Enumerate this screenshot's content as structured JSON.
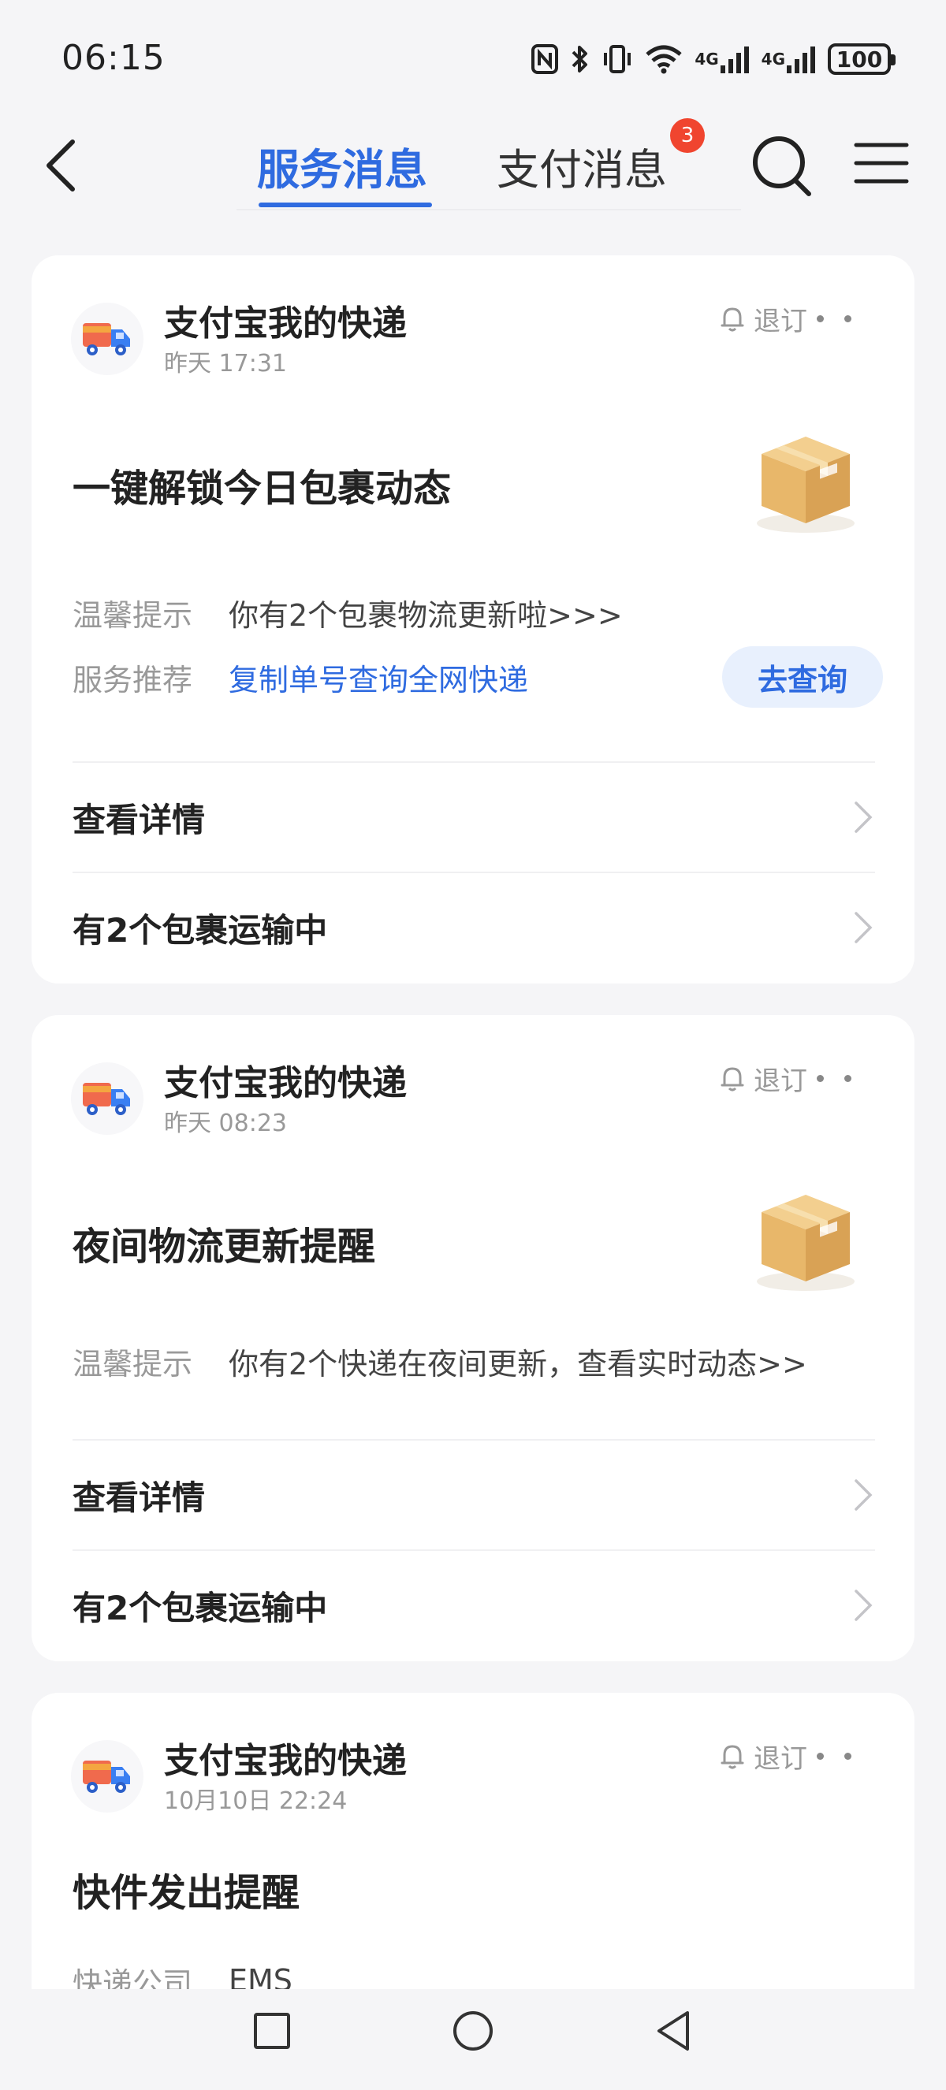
{
  "status": {
    "time": "06:15",
    "network1": "4G",
    "network2": "4G",
    "battery": "100"
  },
  "nav": {
    "tab_service": "服务消息",
    "tab_payment": "支付消息",
    "payment_badge": "3"
  },
  "cards": [
    {
      "app_name": "支付宝我的快递",
      "time": "昨天 17:31",
      "unsubscribe": "退订",
      "title": "一键解锁今日包裹动态",
      "rows": [
        {
          "label": "温馨提示",
          "value": "你有2个包裹物流更新啦>>>"
        },
        {
          "label": "服务推荐",
          "value": "复制单号查询全网快递",
          "button": "去查询"
        }
      ],
      "links": [
        "查看详情",
        "有2个包裹运输中"
      ]
    },
    {
      "app_name": "支付宝我的快递",
      "time": "昨天 08:23",
      "unsubscribe": "退订",
      "title": "夜间物流更新提醒",
      "rows": [
        {
          "label": "温馨提示",
          "value": "你有2个快递在夜间更新，查看实时动态>>"
        }
      ],
      "links": [
        "查看详情",
        "有2个包裹运输中"
      ]
    },
    {
      "app_name": "支付宝我的快递",
      "time": "10月10日 22:24",
      "unsubscribe": "退订",
      "title": "快件发出提醒",
      "rows": [
        {
          "label": "快递公司",
          "value": "EMS"
        }
      ]
    }
  ],
  "icons": {
    "app_logo": "delivery-truck-icon",
    "box": "package-box-icon",
    "bell": "bell-icon",
    "more": "more-dots-icon",
    "chevron": "chevron-right-icon"
  },
  "colors": {
    "accent": "#2f6be0",
    "badge": "#f0452f",
    "background": "#f5f5f7"
  }
}
